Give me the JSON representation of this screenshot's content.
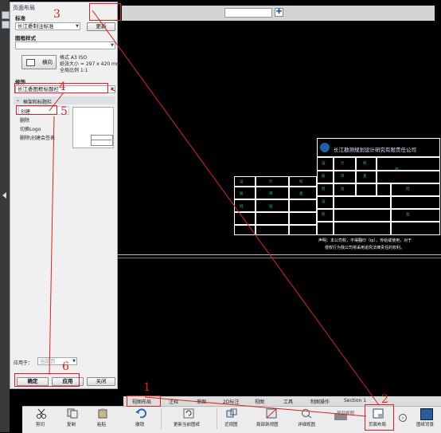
{
  "panel": {
    "title": "页面布局",
    "standard_label": "标准",
    "standard_value": "长江委制注标准",
    "change_button": "更新",
    "frame_style_label": "图框样式",
    "orientation_button": "横向",
    "paper_format": "格式 A3 ISO",
    "paper_size": "纸张大小 = 297 x 420 mm",
    "paper_scale": "全局比例 1:1",
    "decoration_label": "修饰",
    "decoration_value": "长江委图框标题栏",
    "section_header": "框架和标题栏",
    "actions": [
      "创建",
      "删除",
      "切换Logo",
      "删除\\创建会签表"
    ],
    "apply_to_label": "应用于：",
    "apply_to_value": "当前页",
    "ok_button": "确定",
    "apply_button": "应用",
    "close_button": "关闭"
  },
  "annotations": [
    "3",
    "4",
    "5",
    "6",
    "1",
    "2"
  ],
  "drawing": {
    "company": "长江勘测规划设计研究有限责任公司",
    "notice_line1": "声明：本公司权，不得翻印（ip），传给或使用，对于",
    "notice_line2": "侵权行为我公司将采用追究法律责任的权利。",
    "table_marks": [
      "设",
      "计",
      "校",
      "核",
      "审",
      "查",
      "批",
      "准"
    ]
  },
  "ribbon": {
    "tabs": [
      "视图布局",
      "注释",
      "草图",
      "2D标注",
      "视图",
      "工具",
      "制图操作",
      "Section 1"
    ],
    "buttons": [
      "剪切",
      "复制",
      "粘贴",
      "撤销",
      "更新当前图纸",
      "近视图",
      "局部剖视图",
      "详细视图",
      "局部视图",
      "页面布局",
      "图纸背景"
    ]
  },
  "colors": {
    "annotation": "#e02020",
    "dim_green": "#2ecc40",
    "brand_blue": "#1e5fa8"
  }
}
